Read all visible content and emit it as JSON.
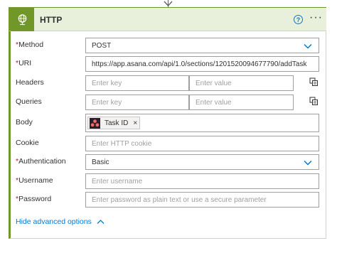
{
  "action": {
    "title": "HTTP",
    "icon": "globe-icon",
    "accent_color": "#709727"
  },
  "fields": {
    "method": {
      "label": "Method",
      "required": true,
      "value": "POST"
    },
    "uri": {
      "label": "URI",
      "required": true,
      "value": "https://app.asana.com/api/1.0/sections/1201520094677790/addTask"
    },
    "headers": {
      "label": "Headers",
      "key_placeholder": "Enter key",
      "value_placeholder": "Enter value"
    },
    "queries": {
      "label": "Queries",
      "key_placeholder": "Enter key",
      "value_placeholder": "Enter value"
    },
    "body": {
      "label": "Body",
      "token": {
        "label": "Task ID",
        "icon": "asana-logo-icon",
        "remove": "×"
      }
    },
    "cookie": {
      "label": "Cookie",
      "placeholder": "Enter HTTP cookie"
    },
    "authentication": {
      "label": "Authentication",
      "required": true,
      "value": "Basic"
    },
    "username": {
      "label": "Username",
      "required": true,
      "placeholder": "Enter username"
    },
    "password": {
      "label": "Password",
      "required": true,
      "placeholder": "Enter password as plain text or use a secure parameter"
    }
  },
  "footer": {
    "hide_advanced_label": "Hide advanced options"
  },
  "req_marker": "*",
  "colors": {
    "link": "#0078d4",
    "required": "#a4262c",
    "header_bg": "#e8f0dc",
    "token_logo_bg": "#2b1d2c",
    "asana_coral": "#f06a6a"
  }
}
